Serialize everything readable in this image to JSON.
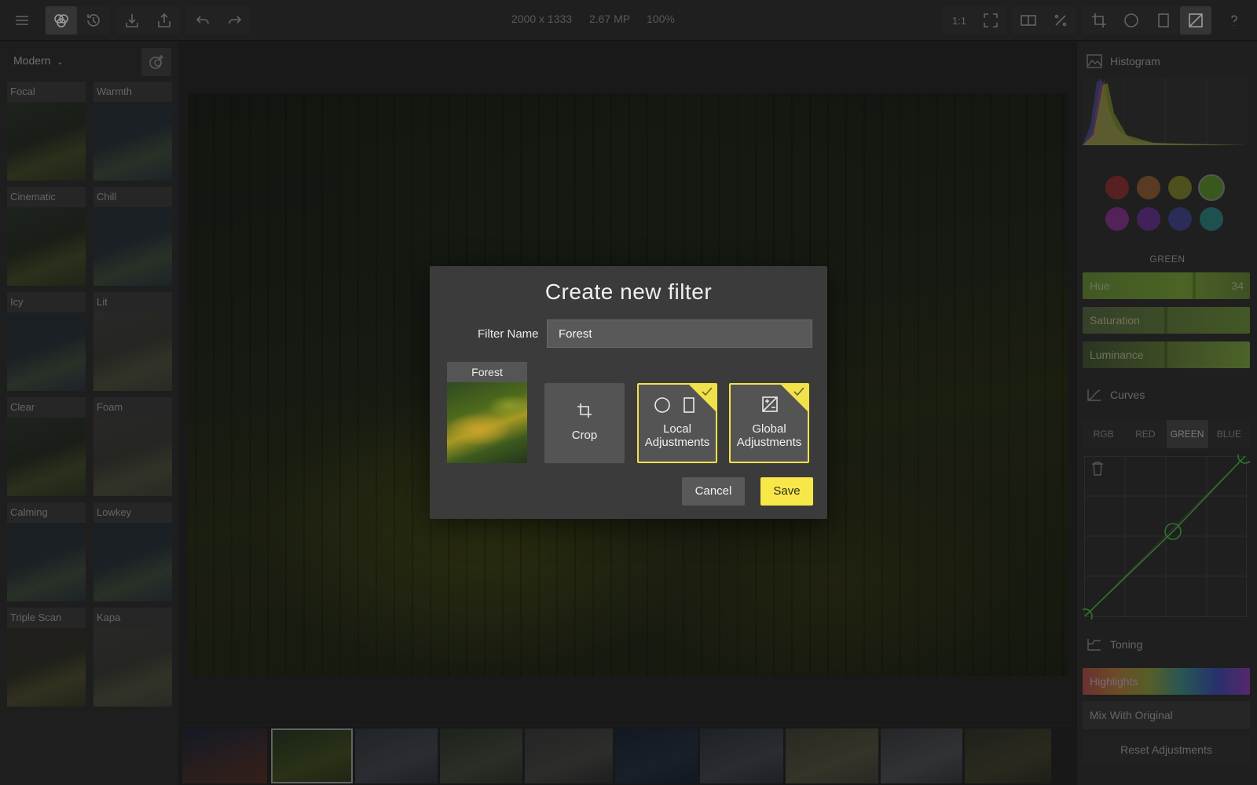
{
  "toolbar": {
    "image_size": "2000 x 1333",
    "megapixels": "2.67 MP",
    "zoom": "100%",
    "one_to_one": "1:1"
  },
  "left_panel": {
    "preset_group": "Modern",
    "filters": [
      {
        "name": "Focal",
        "tone": "base"
      },
      {
        "name": "Warmth",
        "tone": "cool"
      },
      {
        "name": "Cinematic",
        "tone": "base"
      },
      {
        "name": "Chill",
        "tone": "cool"
      },
      {
        "name": "Icy",
        "tone": "cool"
      },
      {
        "name": "Lit",
        "tone": "light"
      },
      {
        "name": "Clear",
        "tone": "base"
      },
      {
        "name": "Foam",
        "tone": "light"
      },
      {
        "name": "Calming",
        "tone": "cool"
      },
      {
        "name": "Lowkey",
        "tone": "cool"
      },
      {
        "name": "Triple Scan",
        "tone": "warm"
      },
      {
        "name": "Kapa",
        "tone": "light"
      }
    ]
  },
  "right_panel": {
    "histogram_title": "Histogram",
    "colors": [
      "#7a2f2f",
      "#7a5230",
      "#6f6f2a",
      "#4f7a2a",
      "#74307a",
      "#5a307a",
      "#3a3f7a",
      "#2a6f6f"
    ],
    "selected_color_index": 3,
    "selected_color_name": "GREEN",
    "hue": {
      "label": "Hue",
      "value": "34"
    },
    "saturation": {
      "label": "Saturation"
    },
    "luminance": {
      "label": "Luminance"
    },
    "curves_title": "Curves",
    "curve_tabs": [
      "RGB",
      "RED",
      "GREEN",
      "BLUE"
    ],
    "active_curve_tab": "GREEN",
    "toning_title": "Toning",
    "highlights": "Highlights",
    "mix_with_original": "Mix With Original",
    "reset": "Reset Adjustments"
  },
  "dialog": {
    "title": "Create new filter",
    "filter_name_label": "Filter Name",
    "filter_name_value": "Forest",
    "preview_name": "Forest",
    "options": [
      {
        "label_line1": "Crop",
        "label_line2": "",
        "checked": false
      },
      {
        "label_line1": "Local",
        "label_line2": "Adjustments",
        "checked": true
      },
      {
        "label_line1": "Global",
        "label_line2": "Adjustments",
        "checked": true
      }
    ],
    "cancel": "Cancel",
    "save": "Save",
    "accent_color": "#f7e748"
  },
  "filmstrip": {
    "selected_index": 1
  }
}
